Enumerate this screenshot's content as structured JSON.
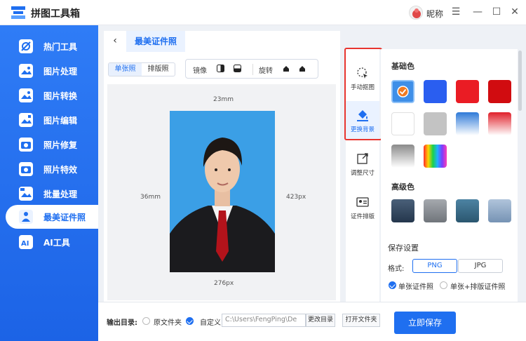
{
  "app": {
    "title": "拼图工具箱",
    "nickname": "昵称"
  },
  "window": {
    "menu_icon": "☰",
    "minimize_icon": "—",
    "maximize_icon": "☐",
    "close_icon": "✕"
  },
  "sidebar": {
    "items": [
      {
        "label": "热门工具",
        "icon": "hot-tools-icon"
      },
      {
        "label": "图片处理",
        "icon": "image-process-icon"
      },
      {
        "label": "图片转换",
        "icon": "image-convert-icon"
      },
      {
        "label": "图片编辑",
        "icon": "image-edit-icon"
      },
      {
        "label": "照片修复",
        "icon": "photo-repair-icon"
      },
      {
        "label": "照片特效",
        "icon": "photo-effect-icon"
      },
      {
        "label": "批量处理",
        "icon": "batch-process-icon"
      },
      {
        "label": "最美证件照",
        "icon": "id-photo-icon",
        "active": true
      },
      {
        "label": "AI工具",
        "icon": "ai-tools-icon"
      }
    ]
  },
  "page": {
    "tab_title": "最美证件照",
    "back": "‹"
  },
  "toolbar": {
    "single": "单张照",
    "layout": "排版照",
    "mirror": "镜像",
    "rotate": "旋转"
  },
  "canvas": {
    "width_mm": "23mm",
    "height_mm": "36mm",
    "height_px": "423px",
    "width_px": "276px"
  },
  "tools": [
    {
      "label": "手动抠图",
      "icon": "manual-cutout-icon"
    },
    {
      "label": "更换背景",
      "icon": "change-background-icon",
      "active": true
    },
    {
      "label": "调整尺寸",
      "icon": "resize-icon"
    },
    {
      "label": "证件排版",
      "icon": "id-layout-icon"
    }
  ],
  "colors": {
    "basic_title": "基础色",
    "basic": [
      "#3f8fe8",
      "#2a5ef0",
      "#ea1c24",
      "#d10c10",
      "#ffffff",
      "#c3c3c3",
      "gradient-blue",
      "gradient-red",
      "gradient-gray",
      "gradient-rainbow"
    ],
    "advanced_title": "高级色",
    "advanced": [
      "#33475f",
      "#8a8e93",
      "#3d6a86",
      "#8fa8c3"
    ],
    "selected": 0
  },
  "save_settings": {
    "title": "保存设置",
    "format_label": "格式:",
    "formats": [
      "PNG",
      "JPG"
    ],
    "selected_format": "PNG",
    "option1": "单张证件照",
    "option2": "单张+排版证件照"
  },
  "output": {
    "label": "输出目录:",
    "original": "原文件夹",
    "custom": "自定义",
    "path": "C:\\Users\\FengPing\\De",
    "change_dir": "更改目录",
    "open_folder": "打开文件夹",
    "save": "立即保存"
  }
}
